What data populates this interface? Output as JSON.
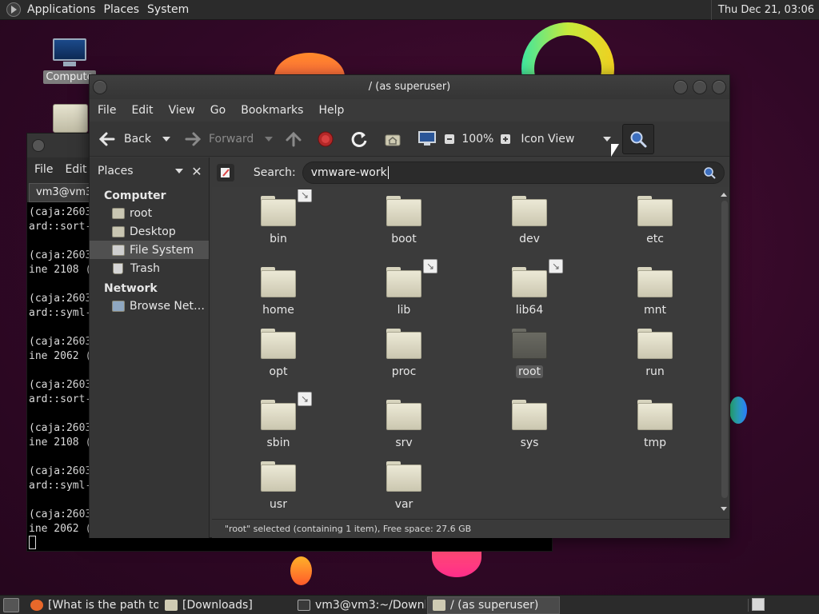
{
  "top_panel": {
    "menus": [
      "Applications",
      "Places",
      "System"
    ],
    "clock": "Thu Dec 21, 03:06"
  },
  "desktop": {
    "computer_label": "Compute"
  },
  "terminal": {
    "menus": [
      "File",
      "Edit"
    ],
    "tab_label": "vm3@vm3:",
    "lines": [
      "(caja:2603",
      "ard::sort-",
      "",
      "(caja:2603",
      "ine 2108 (",
      "",
      "(caja:2603",
      "ard::syml-",
      "",
      "(caja:2603",
      "ine 2062 (",
      "",
      "(caja:2603",
      "ard::sort-",
      "",
      "(caja:2603",
      "ine 2108 (",
      "",
      "(caja:2603",
      "ard::syml-",
      "",
      "(caja:2603",
      "ine 2062 ("
    ]
  },
  "caja": {
    "title": "/ (as superuser)",
    "menus": [
      "File",
      "Edit",
      "View",
      "Go",
      "Bookmarks",
      "Help"
    ],
    "toolbar": {
      "back": "Back",
      "forward": "Forward",
      "zoom": "100%",
      "view_mode": "Icon View"
    },
    "sidebar": {
      "title": "Places",
      "sections": [
        {
          "heading": "Computer",
          "items": [
            {
              "label": "root",
              "icon": "home-icon"
            },
            {
              "label": "Desktop",
              "icon": "desktop-icon"
            },
            {
              "label": "File System",
              "icon": "drive-icon",
              "selected": true
            },
            {
              "label": "Trash",
              "icon": "trash-icon"
            }
          ]
        },
        {
          "heading": "Network",
          "items": [
            {
              "label": "Browse Net…",
              "icon": "network-icon"
            }
          ]
        }
      ]
    },
    "search": {
      "label": "Search:",
      "value": "vmware-work"
    },
    "files": [
      {
        "name": "bin",
        "link": true
      },
      {
        "name": "boot",
        "link": false
      },
      {
        "name": "dev",
        "link": false
      },
      {
        "name": "etc",
        "link": false
      },
      {
        "name": "home",
        "link": false
      },
      {
        "name": "lib",
        "link": true
      },
      {
        "name": "lib64",
        "link": true
      },
      {
        "name": "mnt",
        "link": false
      },
      {
        "name": "opt",
        "link": false
      },
      {
        "name": "proc",
        "link": false
      },
      {
        "name": "root",
        "link": false,
        "selected": true,
        "home": true
      },
      {
        "name": "run",
        "link": false
      },
      {
        "name": "sbin",
        "link": true
      },
      {
        "name": "srv",
        "link": false
      },
      {
        "name": "sys",
        "link": false
      },
      {
        "name": "tmp",
        "link": false
      },
      {
        "name": "usr",
        "link": false
      },
      {
        "name": "var",
        "link": false
      }
    ],
    "status": "\"root\" selected (containing 1 item), Free space: 27.6 GB"
  },
  "taskbar": {
    "tasks": [
      {
        "label": "[What is the path to…",
        "icon": "firefox-icon",
        "color": "#e8682a"
      },
      {
        "label": "[Downloads]",
        "icon": "folder-icon",
        "color": "#cfcbb3"
      },
      {
        "label": "vm3@vm3:~/Downl…",
        "icon": "terminal-icon",
        "color": "#3a3a3a"
      },
      {
        "label": "/ (as superuser)",
        "icon": "folder-icon",
        "color": "#cfcbb3",
        "active": true
      }
    ]
  }
}
